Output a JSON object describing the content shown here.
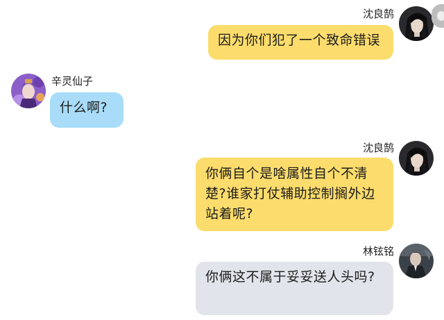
{
  "messages": [
    {
      "sender": "沈良鹄",
      "text": "因为你们犯了一个致命错误",
      "side": "right",
      "bubble_color": "#fcdc6c"
    },
    {
      "sender": "辛灵仙子",
      "text": "什么啊?",
      "side": "left",
      "bubble_color": "#a8dcf8"
    },
    {
      "sender": "沈良鹄",
      "text": "你俩自个是啥属性自个不清楚?谁家打仗辅助控制搁外边站着呢?",
      "side": "right",
      "bubble_color": "#fcdc6c"
    },
    {
      "sender": "林铉铭",
      "text": "你俩这不属于妥妥送人头吗?",
      "side": "right",
      "bubble_color": "#e1e4ea"
    }
  ],
  "avatars": {
    "shen": "dark-hair-character-avatar",
    "xin": "purple-fairy-character-avatar",
    "lin": "dark-suit-character-avatar"
  }
}
